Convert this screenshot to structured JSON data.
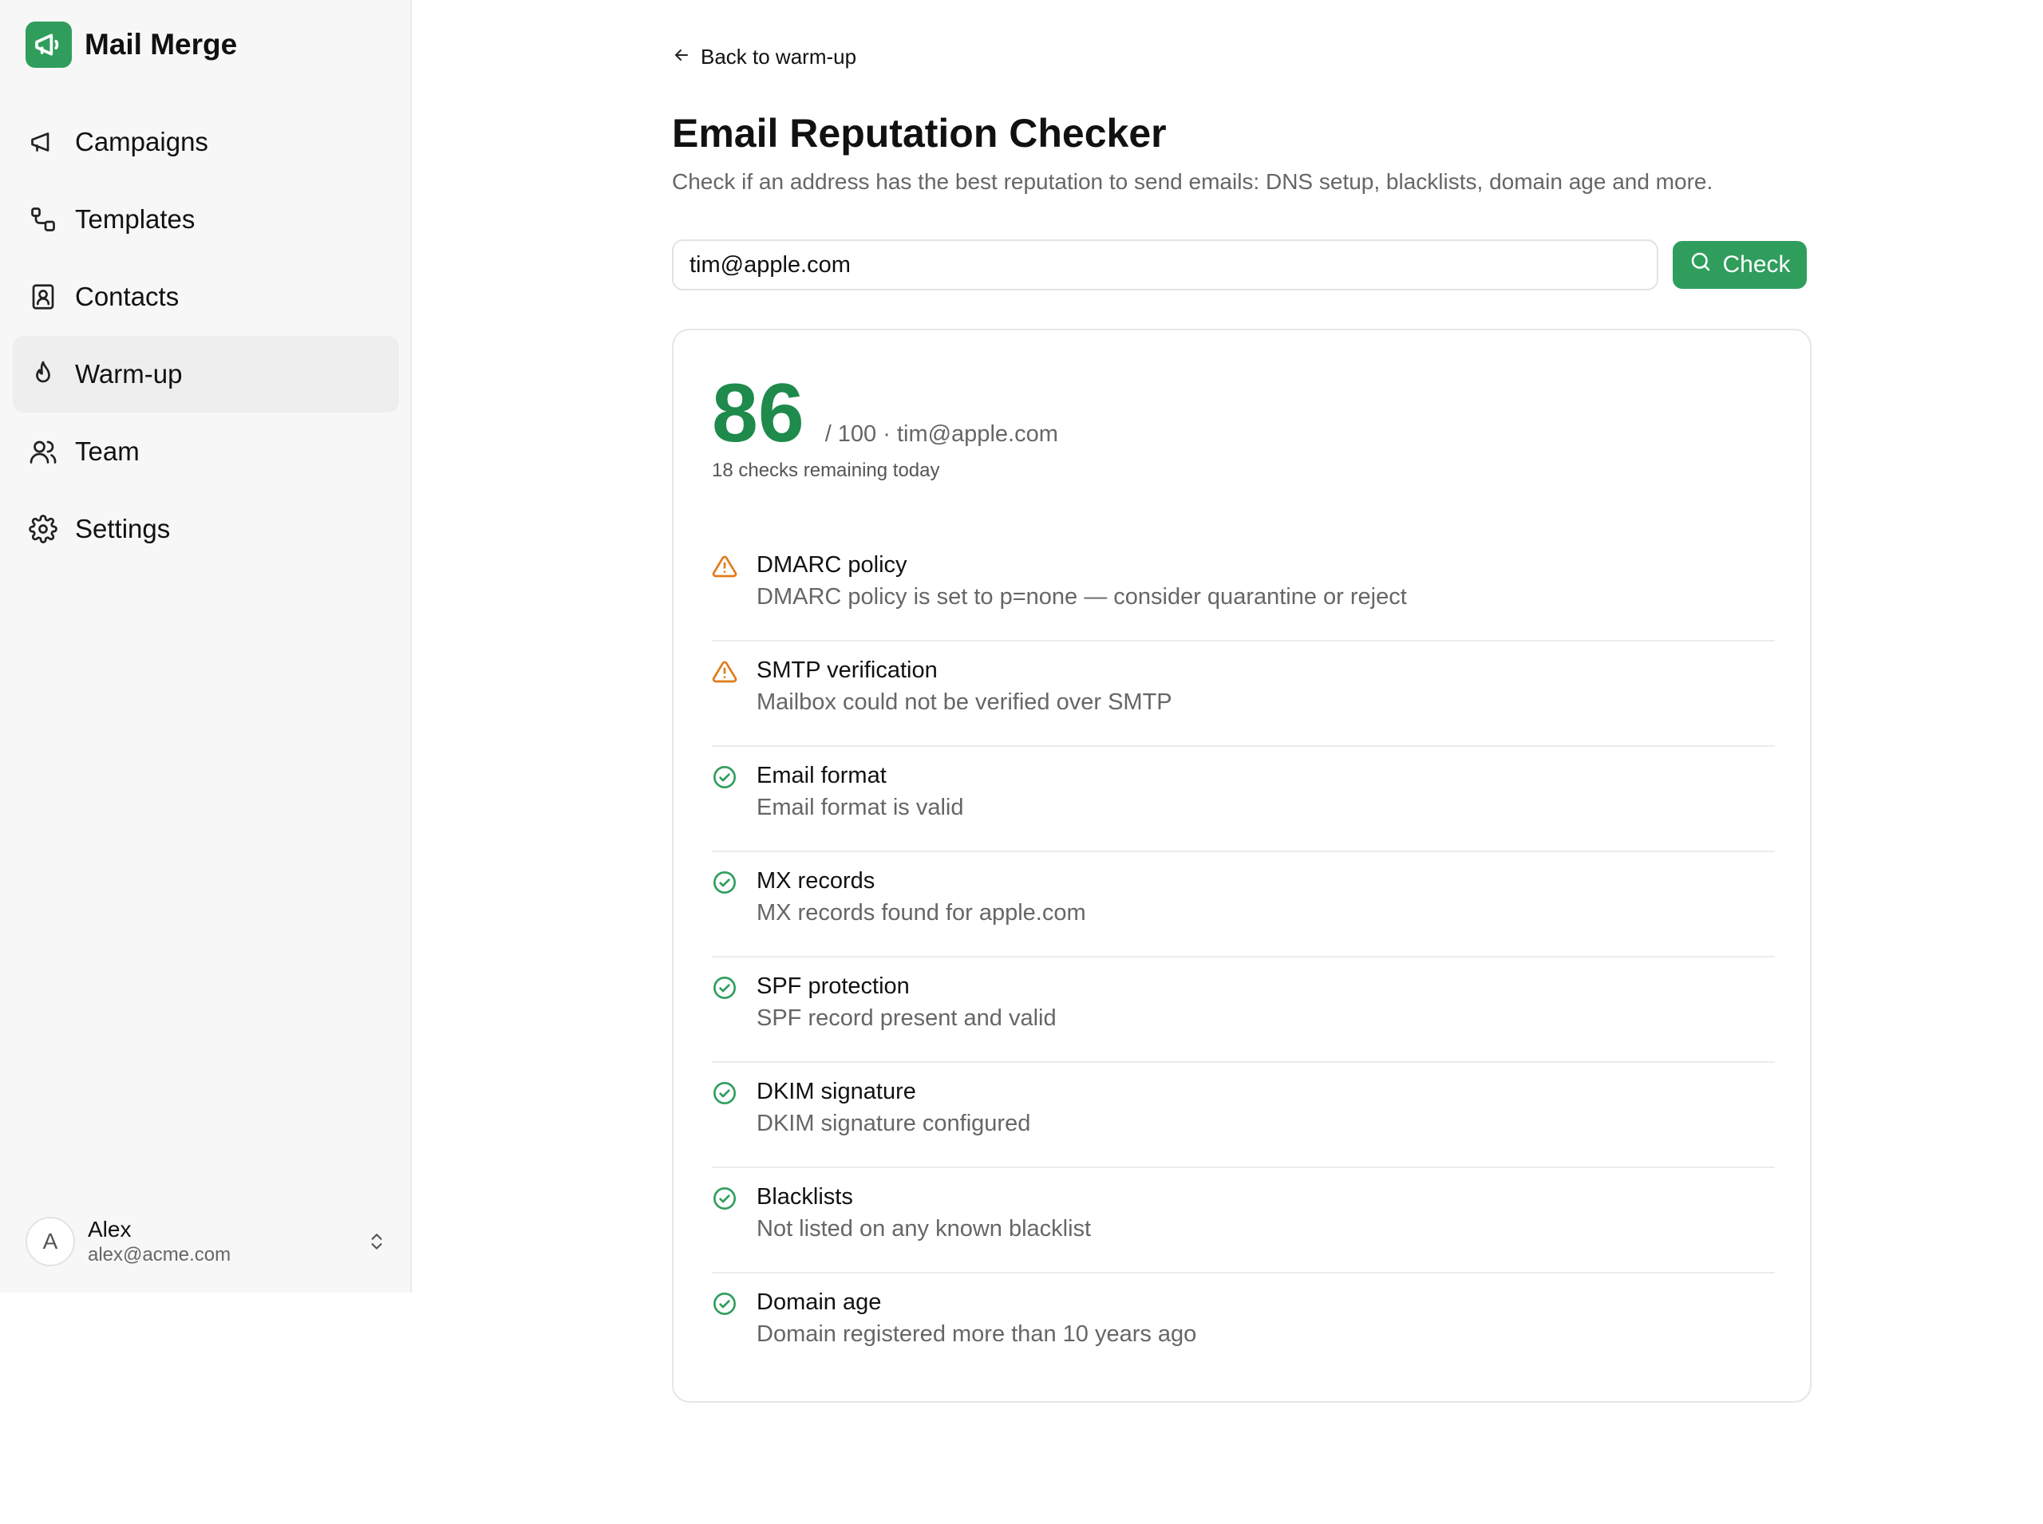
{
  "app": {
    "name": "Mail Merge"
  },
  "sidebar": {
    "items": [
      {
        "label": "Campaigns",
        "icon": "megaphone-icon",
        "active": false
      },
      {
        "label": "Templates",
        "icon": "templates-icon",
        "active": false
      },
      {
        "label": "Contacts",
        "icon": "contacts-icon",
        "active": false
      },
      {
        "label": "Warm-up",
        "icon": "flame-icon",
        "active": true
      },
      {
        "label": "Team",
        "icon": "team-icon",
        "active": false
      },
      {
        "label": "Settings",
        "icon": "gear-icon",
        "active": false
      }
    ],
    "user": {
      "initial": "A",
      "name": "Alex",
      "email": "alex@acme.com"
    }
  },
  "main": {
    "back_label": "Back to warm-up",
    "title": "Email Reputation Checker",
    "subtitle": "Check if an address has the best reputation to send emails: DNS setup, blacklists, domain age and more.",
    "search": {
      "value": "tim@apple.com"
    },
    "check_label": "Check"
  },
  "result": {
    "score": "86",
    "score_meta": "/ 100 · tim@apple.com",
    "remaining": "18 checks remaining today",
    "checks": [
      {
        "status": "warning",
        "name": "DMARC policy",
        "detail": "DMARC policy is set to p=none — consider quarantine or reject"
      },
      {
        "status": "warning",
        "name": "SMTP verification",
        "detail": "Mailbox could not be verified over SMTP"
      },
      {
        "status": "pass",
        "name": "Email format",
        "detail": "Email format is valid"
      },
      {
        "status": "pass",
        "name": "MX records",
        "detail": "MX records found for apple.com"
      },
      {
        "status": "pass",
        "name": "SPF protection",
        "detail": "SPF record present and valid"
      },
      {
        "status": "pass",
        "name": "DKIM signature",
        "detail": "DKIM signature configured"
      },
      {
        "status": "pass",
        "name": "Blacklists",
        "detail": "Not listed on any known blacklist"
      },
      {
        "status": "pass",
        "name": "Domain age",
        "detail": "Domain registered more than 10 years ago"
      }
    ]
  },
  "colors": {
    "accent": "#2f9e5c",
    "score": "#1e8a4c",
    "warning": "#e07b1a",
    "pass": "#2f9e5c"
  }
}
